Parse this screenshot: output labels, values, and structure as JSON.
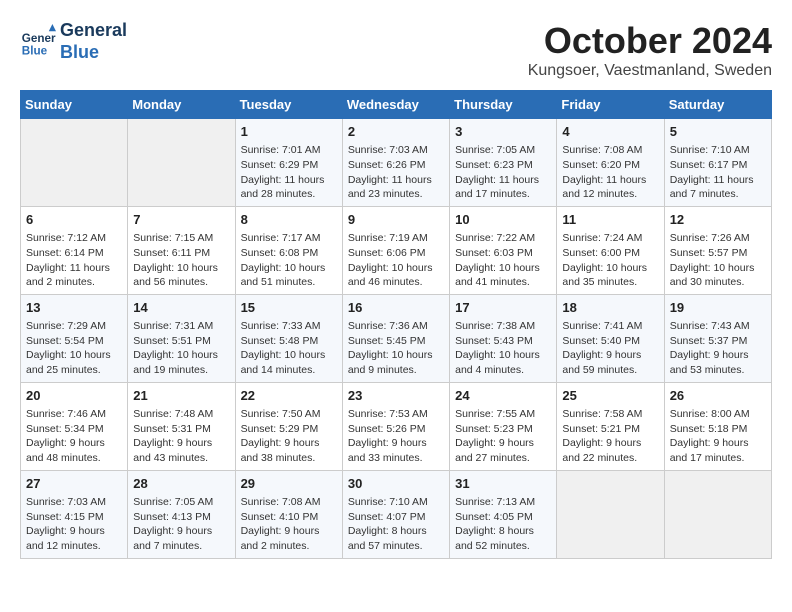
{
  "logo": {
    "line1": "General",
    "line2": "Blue"
  },
  "title": "October 2024",
  "subtitle": "Kungsoer, Vaestmanland, Sweden",
  "headers": [
    "Sunday",
    "Monday",
    "Tuesday",
    "Wednesday",
    "Thursday",
    "Friday",
    "Saturday"
  ],
  "weeks": [
    [
      {
        "day": "",
        "detail": ""
      },
      {
        "day": "",
        "detail": ""
      },
      {
        "day": "1",
        "detail": "Sunrise: 7:01 AM\nSunset: 6:29 PM\nDaylight: 11 hours and 28 minutes."
      },
      {
        "day": "2",
        "detail": "Sunrise: 7:03 AM\nSunset: 6:26 PM\nDaylight: 11 hours and 23 minutes."
      },
      {
        "day": "3",
        "detail": "Sunrise: 7:05 AM\nSunset: 6:23 PM\nDaylight: 11 hours and 17 minutes."
      },
      {
        "day": "4",
        "detail": "Sunrise: 7:08 AM\nSunset: 6:20 PM\nDaylight: 11 hours and 12 minutes."
      },
      {
        "day": "5",
        "detail": "Sunrise: 7:10 AM\nSunset: 6:17 PM\nDaylight: 11 hours and 7 minutes."
      }
    ],
    [
      {
        "day": "6",
        "detail": "Sunrise: 7:12 AM\nSunset: 6:14 PM\nDaylight: 11 hours and 2 minutes."
      },
      {
        "day": "7",
        "detail": "Sunrise: 7:15 AM\nSunset: 6:11 PM\nDaylight: 10 hours and 56 minutes."
      },
      {
        "day": "8",
        "detail": "Sunrise: 7:17 AM\nSunset: 6:08 PM\nDaylight: 10 hours and 51 minutes."
      },
      {
        "day": "9",
        "detail": "Sunrise: 7:19 AM\nSunset: 6:06 PM\nDaylight: 10 hours and 46 minutes."
      },
      {
        "day": "10",
        "detail": "Sunrise: 7:22 AM\nSunset: 6:03 PM\nDaylight: 10 hours and 41 minutes."
      },
      {
        "day": "11",
        "detail": "Sunrise: 7:24 AM\nSunset: 6:00 PM\nDaylight: 10 hours and 35 minutes."
      },
      {
        "day": "12",
        "detail": "Sunrise: 7:26 AM\nSunset: 5:57 PM\nDaylight: 10 hours and 30 minutes."
      }
    ],
    [
      {
        "day": "13",
        "detail": "Sunrise: 7:29 AM\nSunset: 5:54 PM\nDaylight: 10 hours and 25 minutes."
      },
      {
        "day": "14",
        "detail": "Sunrise: 7:31 AM\nSunset: 5:51 PM\nDaylight: 10 hours and 19 minutes."
      },
      {
        "day": "15",
        "detail": "Sunrise: 7:33 AM\nSunset: 5:48 PM\nDaylight: 10 hours and 14 minutes."
      },
      {
        "day": "16",
        "detail": "Sunrise: 7:36 AM\nSunset: 5:45 PM\nDaylight: 10 hours and 9 minutes."
      },
      {
        "day": "17",
        "detail": "Sunrise: 7:38 AM\nSunset: 5:43 PM\nDaylight: 10 hours and 4 minutes."
      },
      {
        "day": "18",
        "detail": "Sunrise: 7:41 AM\nSunset: 5:40 PM\nDaylight: 9 hours and 59 minutes."
      },
      {
        "day": "19",
        "detail": "Sunrise: 7:43 AM\nSunset: 5:37 PM\nDaylight: 9 hours and 53 minutes."
      }
    ],
    [
      {
        "day": "20",
        "detail": "Sunrise: 7:46 AM\nSunset: 5:34 PM\nDaylight: 9 hours and 48 minutes."
      },
      {
        "day": "21",
        "detail": "Sunrise: 7:48 AM\nSunset: 5:31 PM\nDaylight: 9 hours and 43 minutes."
      },
      {
        "day": "22",
        "detail": "Sunrise: 7:50 AM\nSunset: 5:29 PM\nDaylight: 9 hours and 38 minutes."
      },
      {
        "day": "23",
        "detail": "Sunrise: 7:53 AM\nSunset: 5:26 PM\nDaylight: 9 hours and 33 minutes."
      },
      {
        "day": "24",
        "detail": "Sunrise: 7:55 AM\nSunset: 5:23 PM\nDaylight: 9 hours and 27 minutes."
      },
      {
        "day": "25",
        "detail": "Sunrise: 7:58 AM\nSunset: 5:21 PM\nDaylight: 9 hours and 22 minutes."
      },
      {
        "day": "26",
        "detail": "Sunrise: 8:00 AM\nSunset: 5:18 PM\nDaylight: 9 hours and 17 minutes."
      }
    ],
    [
      {
        "day": "27",
        "detail": "Sunrise: 7:03 AM\nSunset: 4:15 PM\nDaylight: 9 hours and 12 minutes."
      },
      {
        "day": "28",
        "detail": "Sunrise: 7:05 AM\nSunset: 4:13 PM\nDaylight: 9 hours and 7 minutes."
      },
      {
        "day": "29",
        "detail": "Sunrise: 7:08 AM\nSunset: 4:10 PM\nDaylight: 9 hours and 2 minutes."
      },
      {
        "day": "30",
        "detail": "Sunrise: 7:10 AM\nSunset: 4:07 PM\nDaylight: 8 hours and 57 minutes."
      },
      {
        "day": "31",
        "detail": "Sunrise: 7:13 AM\nSunset: 4:05 PM\nDaylight: 8 hours and 52 minutes."
      },
      {
        "day": "",
        "detail": ""
      },
      {
        "day": "",
        "detail": ""
      }
    ]
  ]
}
